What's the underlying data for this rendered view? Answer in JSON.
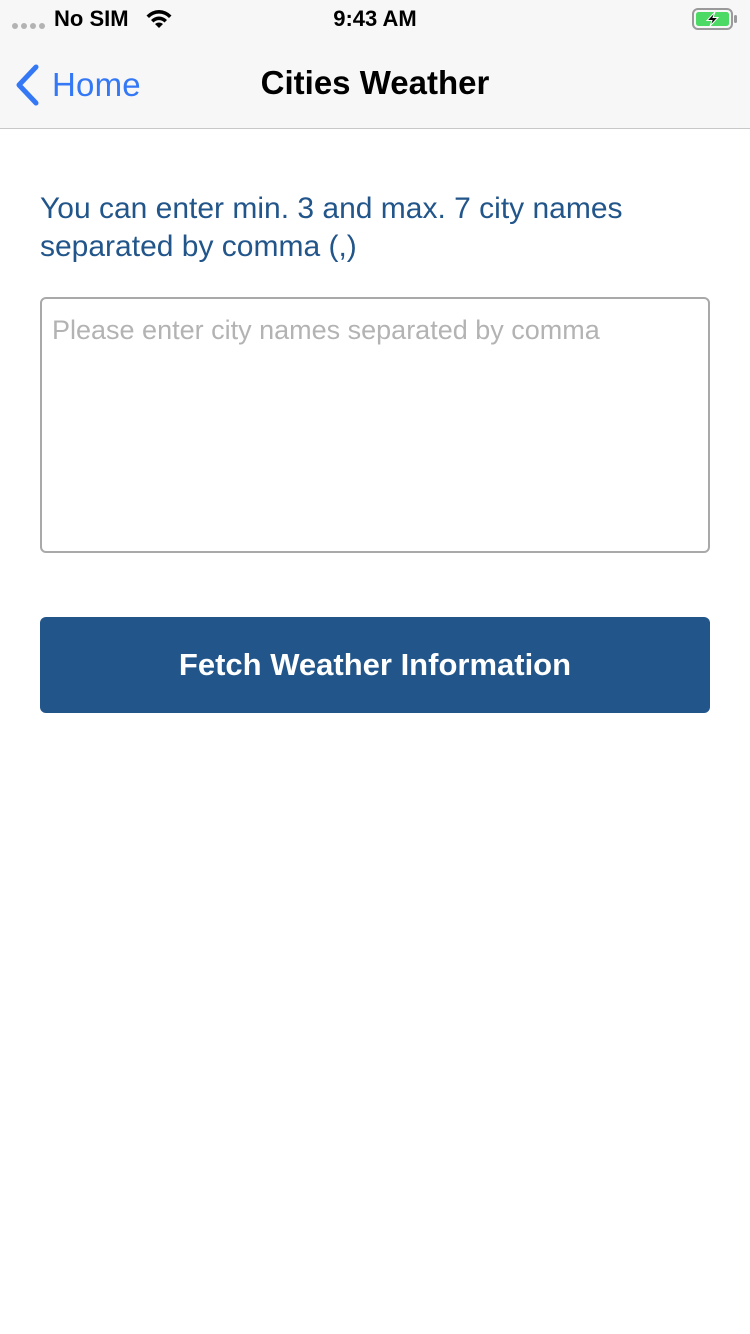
{
  "status_bar": {
    "carrier": "No SIM",
    "time": "9:43 AM",
    "icons": [
      "signal-dots-icon",
      "wifi-icon",
      "battery-charging-icon"
    ]
  },
  "nav": {
    "back_label": "Home",
    "title": "Cities Weather"
  },
  "content": {
    "instructions": "You can enter min. 3 and max. 7 city names separated by comma (,)",
    "input_value": "",
    "input_placeholder": "Please enter city names separated by comma",
    "button_label": "Fetch Weather Information"
  },
  "colors": {
    "accent_blue": "#3478f6",
    "brand_blue": "#22558a",
    "battery_green": "#4cd964"
  }
}
